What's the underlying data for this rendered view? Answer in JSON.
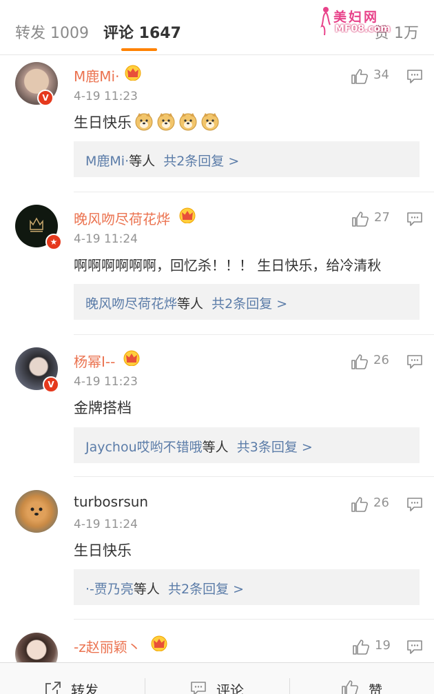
{
  "tabs": {
    "repost": "转发 1009",
    "comment": "评论 1647",
    "like": "赞 1万"
  },
  "watermark": {
    "title": "美妇网",
    "url": "MF08.com"
  },
  "comments": [
    {
      "username": "M鹿Mi·",
      "time": "4-19 11:23",
      "text": "生日快乐",
      "likes": "34",
      "reply_names": "M鹿Mi·",
      "reply_mid": "等人",
      "reply_count": "共2条回复 >"
    },
    {
      "username": "晚风吻尽荷花烨",
      "time": "4-19 11:24",
      "text": "啊啊啊啊啊啊，回忆杀！！！ 生日快乐，给冷清秋",
      "likes": "27",
      "reply_names": "晚风吻尽荷花烨",
      "reply_mid": "等人",
      "reply_count": "共2条回复 >"
    },
    {
      "username": "杨幂I--",
      "time": "4-19 11:23",
      "text": "金牌搭档",
      "likes": "26",
      "reply_names": "Jaychou哎哟不错哦",
      "reply_mid": "等人",
      "reply_count": "共3条回复 >"
    },
    {
      "username": "turbosrsun",
      "time": "4-19 11:24",
      "text": "生日快乐",
      "likes": "26",
      "reply_names": "·-贾乃亮",
      "reply_mid": "等人",
      "reply_count": "共2条回复 >"
    },
    {
      "username": "-z赵丽颖丶",
      "likes": "19"
    }
  ],
  "bottom_bar": {
    "repost": "转发",
    "comment": "评论",
    "like": "赞"
  },
  "colors": {
    "accent": "#ff8200",
    "username": "#eb7350",
    "link": "#5b7ca8",
    "badge": "#e5391d"
  },
  "icons": [
    "thumbs-up-icon",
    "message-icon",
    "crown-icon",
    "doge-emoji-icon",
    "share-icon",
    "verified-badge-icon"
  ]
}
